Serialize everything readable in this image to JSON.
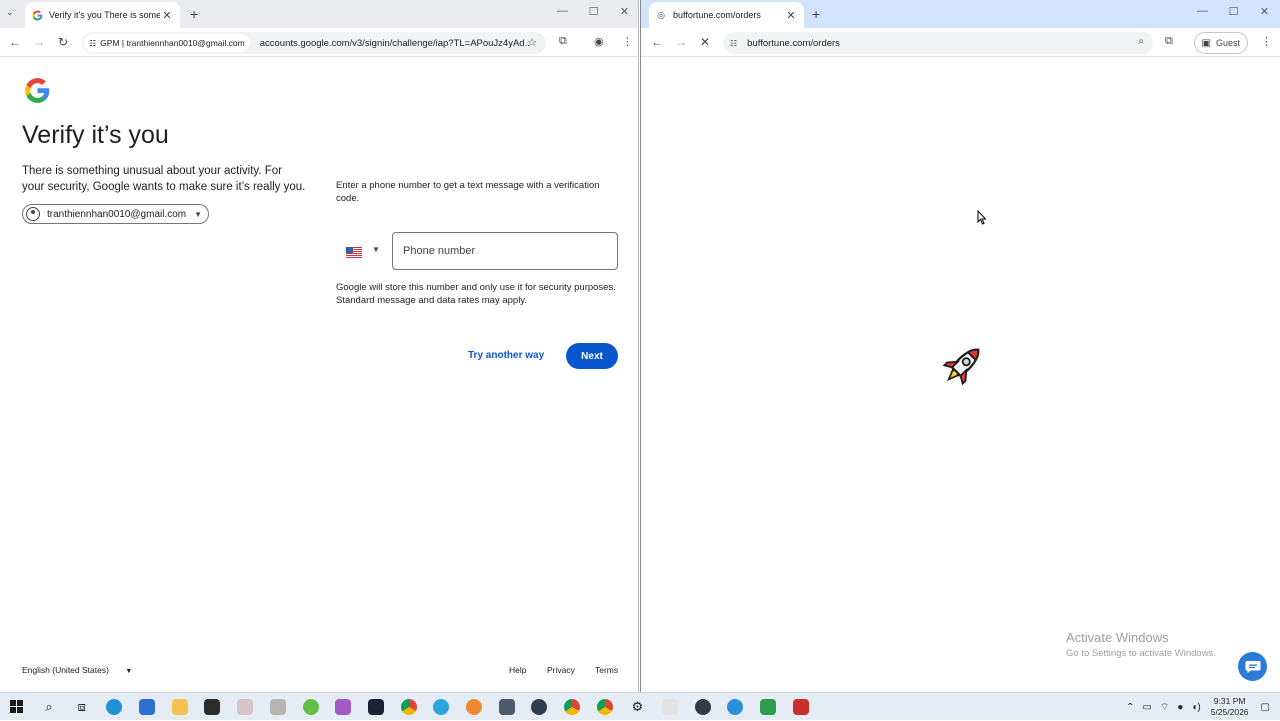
{
  "left_browser": {
    "tab_title": "Verify it's you There is somethi",
    "profile_chip": "GPM | tranthiennhan0010@gmail.com",
    "url": "accounts.google.com/v3/signin/challenge/iap?TL=APouJz4yAd..."
  },
  "google": {
    "title": "Verify it’s you",
    "description": "There is something unusual about your activity. For your security, Google wants to make sure it’s really you.",
    "account_email": "tranthiennhan0010@gmail.com",
    "prompt": "Enter a phone number to get a text message with a verification code.",
    "phone_placeholder": "Phone number",
    "note": "Google will store this number and only use it for security purposes. Standard message and data rates may apply.",
    "try_another": "Try another way",
    "next": "Next",
    "footer": {
      "language": "English (United States)",
      "help": "Help",
      "privacy": "Privacy",
      "terms": "Terms"
    }
  },
  "right_browser": {
    "tab_title": "buffortune.com/orders",
    "url": "buffortune.com/orders",
    "profile": "Guest"
  },
  "watermark": {
    "line1": "Activate Windows",
    "line2": "Go to Settings to activate Windows."
  },
  "taskbar": {
    "time": "9:31 PM",
    "date": "5/25/2026"
  }
}
